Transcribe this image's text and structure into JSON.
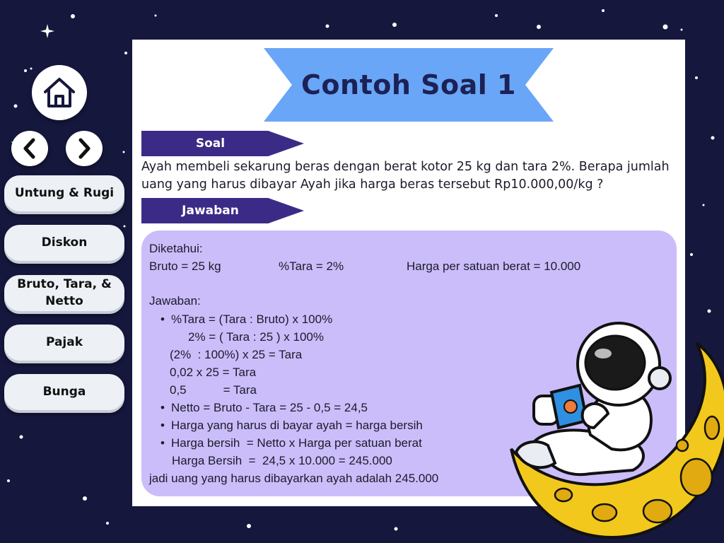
{
  "nav": {
    "items": [
      "Untung & Rugi",
      "Diskon",
      "Bruto, Tara, & Netto",
      "Pajak",
      "Bunga"
    ]
  },
  "title": "Contoh Soal 1",
  "soal": {
    "label": "Soal",
    "text": "Ayah membeli sekarung beras dengan berat kotor 25 kg dan tara 2%. Berapa jumlah uang yang harus dibayar Ayah jika harga beras tersebut Rp10.000,00/kg ?"
  },
  "jawaban": {
    "label": "Jawaban",
    "diketahui": "Diketahui:",
    "bruto": "Bruto = 25 kg",
    "tara": "%Tara = 2%",
    "harga": "Harga per satuan berat = 10.000",
    "jawaban_heading": "Jawaban:",
    "line1": "%Tara = (Tara : Bruto) x 100%",
    "line2": "2% = ( Tara : 25 ) x 100%",
    "line3": "(2%  : 100%) x 25 = Tara",
    "line4": "0,02 x 25 = Tara",
    "line5": "0,5           = Tara",
    "line6": "Netto = Bruto - Tara = 25 - 0,5 = 24,5",
    "line7": "Harga yang harus di bayar ayah = harga bersih",
    "line8": "Harga bersih  = Netto x Harga per satuan berat",
    "line9": "Harga Bersih  =  24,5 x 10.000 = 245.000",
    "conclusion": "jadi uang yang harus dibayarkan ayah adalah 245.000"
  },
  "colors": {
    "background": "#15173d",
    "banner": "#6aa6f7",
    "tag": "#3b2b87",
    "answer_box": "#cbbdfa",
    "moon": "#f2c81c"
  },
  "icons": [
    "home-icon",
    "chevron-left-icon",
    "chevron-right-icon"
  ]
}
